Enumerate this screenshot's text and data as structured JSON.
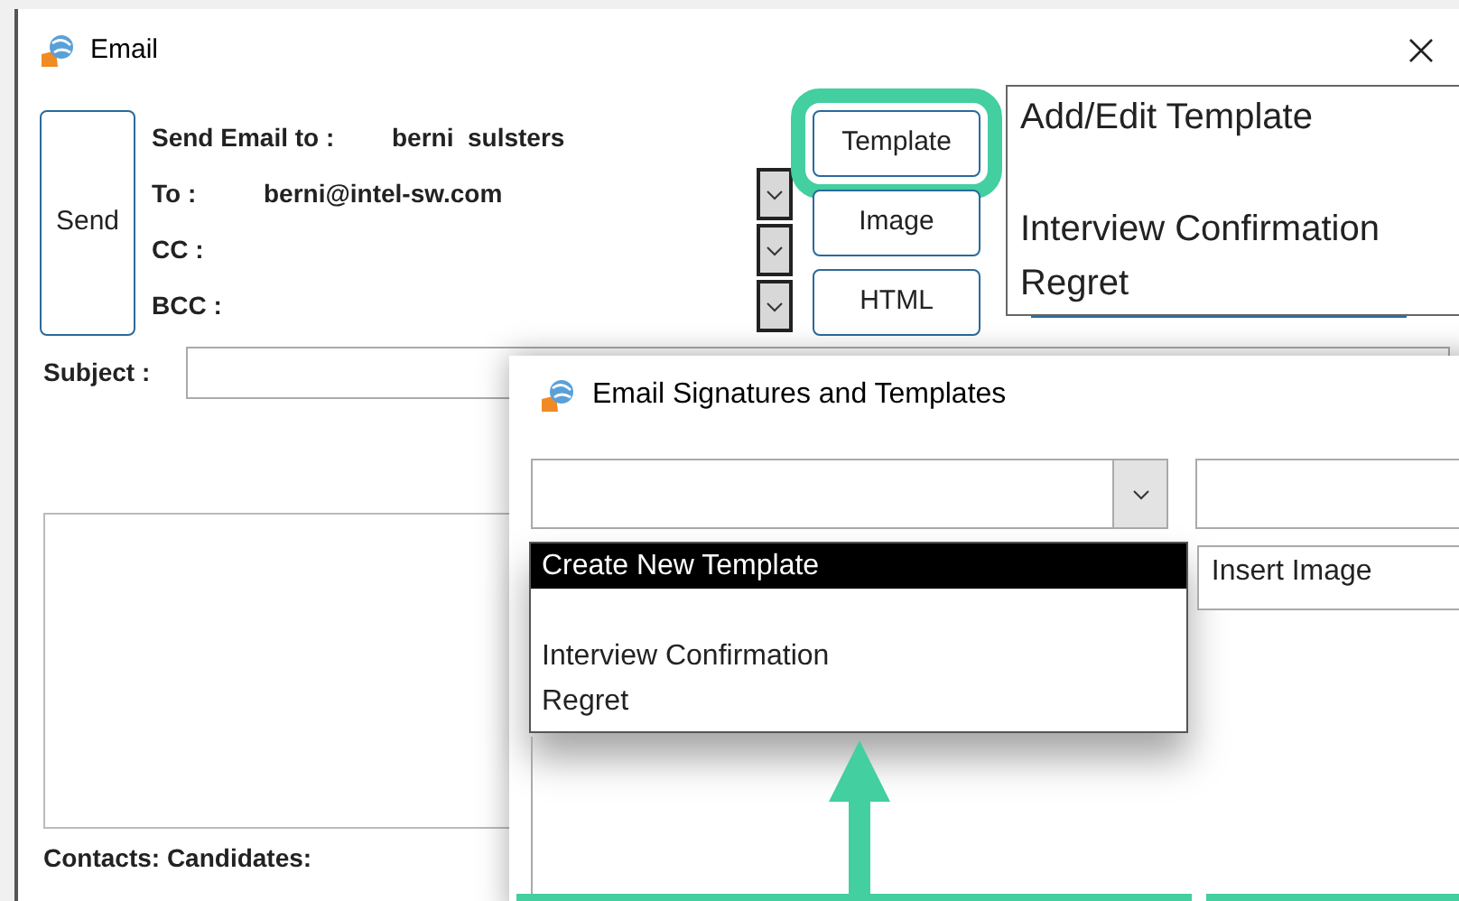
{
  "email_window": {
    "title": "Email",
    "send_button": "Send",
    "fields": [
      {
        "label": "Send Email to :",
        "value": "berni  sulsters",
        "has_dropdown": false
      },
      {
        "label": "To :",
        "value": "berni@intel-sw.com",
        "has_dropdown": true
      },
      {
        "label": "CC :",
        "has_dropdown": true
      },
      {
        "label": "BCC :",
        "has_dropdown": true
      }
    ],
    "buttons": [
      {
        "label": "Template",
        "highlighted": true
      },
      {
        "label": "Image",
        "highlighted": false
      },
      {
        "label": "HTML",
        "highlighted": false
      }
    ],
    "subject_label": "Subject :",
    "contacts_label": "Contacts: Candidates:"
  },
  "template_menu": {
    "items": [
      {
        "kind": "item",
        "label": "Add/Edit Template"
      },
      {
        "kind": "blank"
      },
      {
        "kind": "item",
        "label": "Interview Confirmation"
      },
      {
        "kind": "item",
        "label": "Regret"
      }
    ]
  },
  "signatures_window": {
    "title": "Email Signatures and Templates",
    "template_list": [
      {
        "kind": "item",
        "label": "Create New Template",
        "selected": true
      },
      {
        "kind": "blank",
        "selected": false
      },
      {
        "kind": "item",
        "label": "Interview Confirmation",
        "selected": false
      },
      {
        "kind": "item",
        "label": "Regret",
        "selected": false
      }
    ],
    "insert_list": [
      {
        "label": "Insert Image"
      }
    ]
  }
}
